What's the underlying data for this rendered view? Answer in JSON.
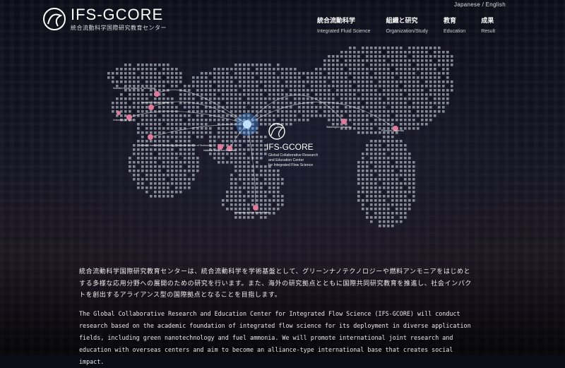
{
  "header": {
    "logo_title": "IFS-GCORE",
    "logo_subtitle": "統合流動科学国際研究教育センター",
    "language_switch": "Japanese / English",
    "nav": [
      {
        "ja": "統合流動科学",
        "en": "Integrated Fluid Science"
      },
      {
        "ja": "組織と研究",
        "en": "Organization/Study"
      },
      {
        "ja": "教育",
        "en": "Education"
      },
      {
        "ja": "成果",
        "en": "Result"
      }
    ]
  },
  "map": {
    "center_title": "IFS-GCORE",
    "center_lines": [
      "Global Collaborative Research",
      "and Education Center",
      "for Integrated Flow Science"
    ],
    "partners": [
      "Swedish Royal Institute of Technology",
      "Imperial College London",
      "University of Lyon",
      "Technical Institute of Technology Karlsruhe Institute of Technology",
      "National Tsing Hua University",
      "Washington University",
      "Princeton University",
      "University of New South Wales"
    ]
  },
  "content": {
    "jp": "統合流動科学国際研究教育センターは、統合流動科学を学術基盤として、グリーンナノテクノロジーや燃料アンモニアをはじめとする多様な応用分野への展開のための研究を行います。また、海外の研究拠点とともに国際共同研究教育を推進し、社会インパクトを創出するアライアンス型の国際拠点となることを目指します。",
    "en": "The Global Collaborative Research and Education Center for Integrated Flow Science (IFS-GCORE) will conduct research based on the academic foundation of integrated flow science for its deployment in diverse application fields, including green nanotechnology and fuel ammonia. We will promote international joint research and education with overseas centers and aim to become an alliance-type international base that creates social impact."
  },
  "colors": {
    "accent": "#7ab8ff",
    "node": "#e07a9a",
    "dot": "#dfe6f0"
  }
}
